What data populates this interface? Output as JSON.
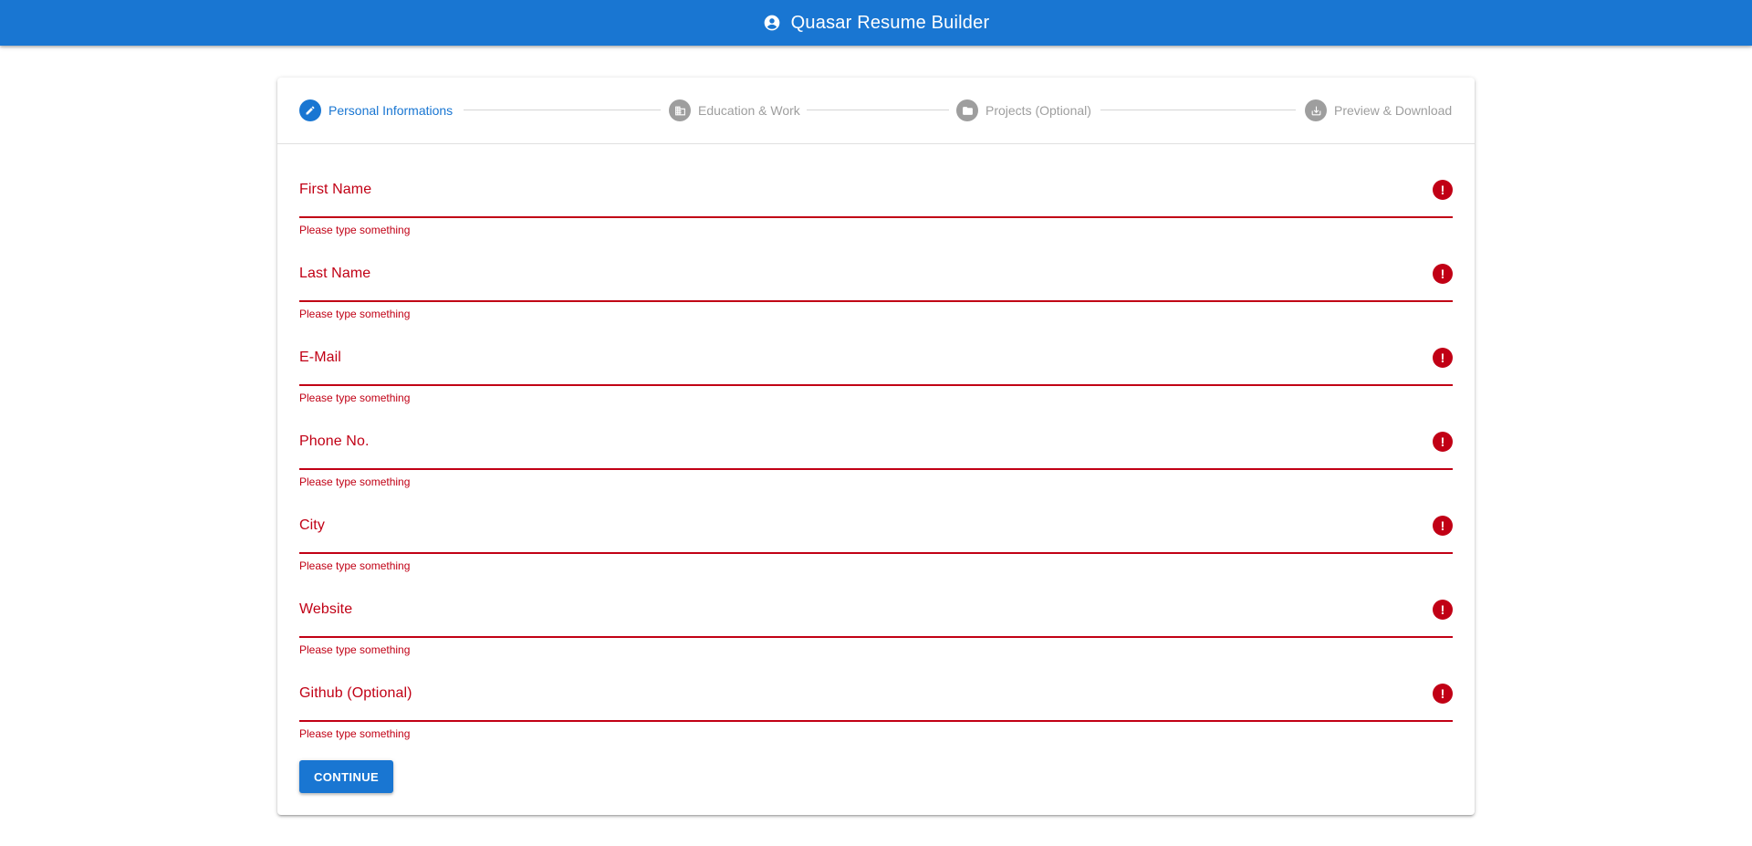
{
  "header": {
    "title": "Quasar Resume Builder",
    "icon": "account-circle-icon",
    "background": "#1976d2"
  },
  "stepper": {
    "steps": [
      {
        "label": "Personal Informations",
        "icon": "pencil-icon",
        "active": true
      },
      {
        "label": "Education & Work",
        "icon": "business-icon",
        "active": false
      },
      {
        "label": "Projects (Optional)",
        "icon": "folder-icon",
        "active": false
      },
      {
        "label": "Preview & Download",
        "icon": "download-icon",
        "active": false
      }
    ]
  },
  "form": {
    "fields": [
      {
        "label": "First Name",
        "value": "",
        "error": "Please type something"
      },
      {
        "label": "Last Name",
        "value": "",
        "error": "Please type something"
      },
      {
        "label": "E-Mail",
        "value": "",
        "error": "Please type something"
      },
      {
        "label": "Phone No.",
        "value": "",
        "error": "Please type something"
      },
      {
        "label": "City",
        "value": "",
        "error": "Please type something"
      },
      {
        "label": "Website",
        "value": "",
        "error": "Please type something"
      },
      {
        "label": "Github (Optional)",
        "value": "",
        "error": "Please type something"
      }
    ],
    "continue_label": "CONTINUE"
  },
  "colors": {
    "primary": "#1976d2",
    "error": "#c10015",
    "inactive": "#9e9e9e"
  }
}
